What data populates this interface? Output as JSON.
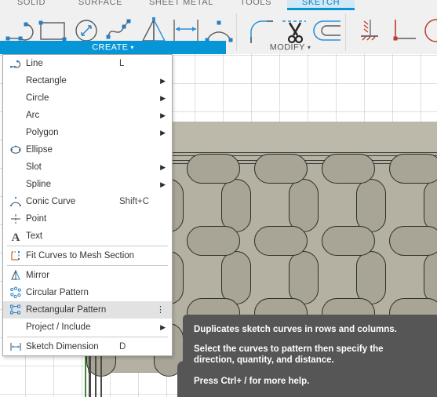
{
  "app": {
    "accent_blue": "#0696d7",
    "tab_active_bg": "#cfe9f7",
    "menu_bg": "#ffffff",
    "menu_selected_bg": "#e2e2e2",
    "tooltip_bg": "#565656",
    "ribbon_bg": "#f0f0f0"
  },
  "tabs": [
    {
      "label": "SOLID",
      "active": false
    },
    {
      "label": "SURFACE",
      "active": false
    },
    {
      "label": "SHEET METAL",
      "active": false
    },
    {
      "label": "TOOLS",
      "active": false
    },
    {
      "label": "SKETCH",
      "active": true
    }
  ],
  "ribbon": {
    "groups": [
      {
        "name": "CREATE",
        "label": "CREATE",
        "caret": "▾"
      },
      {
        "name": "MODIFY",
        "label": "MODIFY",
        "caret": "▾"
      }
    ],
    "create_tools": [
      {
        "name": "line-tool-icon"
      },
      {
        "name": "rectangle-tool-icon"
      },
      {
        "name": "circle-tool-icon"
      },
      {
        "name": "spline-tool-icon"
      },
      {
        "name": "mirror-tool-icon"
      },
      {
        "name": "sketch-dimension-tool-icon"
      },
      {
        "name": "conic-curve-tool-icon"
      }
    ],
    "modify_tools": [
      {
        "name": "fillet-tool-icon"
      },
      {
        "name": "trim-tool-icon"
      },
      {
        "name": "offset-tool-icon"
      }
    ],
    "constraint_tools": [
      {
        "name": "fix-ground-constraint-icon"
      },
      {
        "name": "perpendicular-constraint-icon"
      },
      {
        "name": "tangent-constraint-icon"
      }
    ]
  },
  "create_menu": {
    "title": "CREATE",
    "items": [
      {
        "label": "Line",
        "shortcut": "L",
        "icon": "line-icon",
        "submenu": false,
        "selected": false
      },
      {
        "label": "Rectangle",
        "shortcut": "",
        "icon": "",
        "submenu": true,
        "selected": false
      },
      {
        "label": "Circle",
        "shortcut": "",
        "icon": "",
        "submenu": true,
        "selected": false
      },
      {
        "label": "Arc",
        "shortcut": "",
        "icon": "",
        "submenu": true,
        "selected": false
      },
      {
        "label": "Polygon",
        "shortcut": "",
        "icon": "",
        "submenu": true,
        "selected": false
      },
      {
        "label": "Ellipse",
        "shortcut": "",
        "icon": "ellipse-icon",
        "submenu": false,
        "selected": false
      },
      {
        "label": "Slot",
        "shortcut": "",
        "icon": "",
        "submenu": true,
        "selected": false
      },
      {
        "label": "Spline",
        "shortcut": "",
        "icon": "",
        "submenu": true,
        "selected": false
      },
      {
        "label": "Conic Curve",
        "shortcut": "Shift+C",
        "icon": "conic-curve-icon",
        "submenu": false,
        "selected": false
      },
      {
        "label": "Point",
        "shortcut": "",
        "icon": "point-icon",
        "submenu": false,
        "selected": false
      },
      {
        "label": "Text",
        "shortcut": "",
        "icon": "text-icon",
        "submenu": false,
        "selected": false
      },
      {
        "label": "Fit Curves to Mesh Section",
        "shortcut": "",
        "icon": "fit-curves-icon",
        "submenu": false,
        "selected": false
      },
      {
        "label": "Mirror",
        "shortcut": "",
        "icon": "mirror-icon",
        "submenu": false,
        "selected": false
      },
      {
        "label": "Circular Pattern",
        "shortcut": "",
        "icon": "circular-pattern-icon",
        "submenu": false,
        "selected": false
      },
      {
        "label": "Rectangular Pattern",
        "shortcut": "",
        "icon": "rectangular-pattern-icon",
        "submenu": false,
        "selected": true,
        "overflow": "⋮"
      },
      {
        "label": "Project / Include",
        "shortcut": "",
        "icon": "",
        "submenu": true,
        "selected": false
      },
      {
        "label": "Sketch Dimension",
        "shortcut": "D",
        "icon": "sketch-dimension-icon",
        "submenu": false,
        "selected": false
      }
    ]
  },
  "tooltip": {
    "line1": "Duplicates sketch curves in rows and columns.",
    "line2": "Select the curves to pattern then specify the",
    "line3": "direction, quantity, and distance.",
    "line4": "Press Ctrl+ / for more help."
  }
}
